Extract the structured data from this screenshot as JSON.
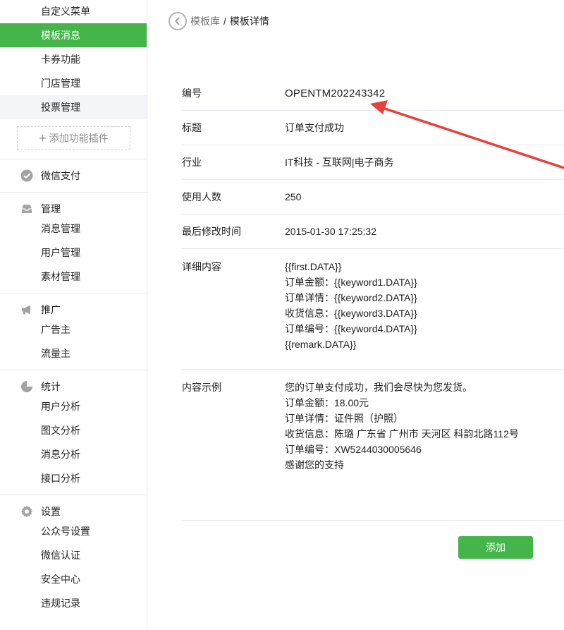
{
  "sidebar": {
    "top_items": [
      "自定义菜单",
      "模板消息",
      "卡券功能",
      "门店管理",
      "投票管理"
    ],
    "add_plugin_label": "添加功能插件",
    "wechat_pay": "微信支付",
    "manage": {
      "title": "管理",
      "items": [
        "消息管理",
        "用户管理",
        "素材管理"
      ]
    },
    "promote": {
      "title": "推广",
      "items": [
        "广告主",
        "流量主"
      ]
    },
    "stats": {
      "title": "统计",
      "items": [
        "用户分析",
        "图文分析",
        "消息分析",
        "接口分析"
      ]
    },
    "settings": {
      "title": "设置",
      "items": [
        "公众号设置",
        "微信认证",
        "安全中心",
        "违规记录"
      ]
    }
  },
  "breadcrumb": {
    "parent": "模板库",
    "separator": "/",
    "current": "模板详情"
  },
  "detail": {
    "id_label": "编号",
    "id_value": "OPENTM202243342",
    "title_label": "标题",
    "title_value": "订单支付成功",
    "industry_label": "行业",
    "industry_value": "IT科技 - 互联网|电子商务",
    "users_label": "使用人数",
    "users_value": "250",
    "modified_label": "最后修改时间",
    "modified_value": "2015-01-30 17:25:32",
    "content_label": "详细内容",
    "content_lines": [
      "{{first.DATA}}",
      "订单金额：{{keyword1.DATA}}",
      "订单详情：{{keyword2.DATA}}",
      "收货信息：{{keyword3.DATA}}",
      "订单编号：{{keyword4.DATA}}",
      "{{remark.DATA}}"
    ],
    "example_label": "内容示例",
    "example_lines": [
      "您的订单支付成功，我们会尽快为您发货。",
      "订单金额：18.00元",
      "订单详情：证件照（护照）",
      "收货信息：陈璐 广东省 广州市 天河区 科韵北路112号",
      "订单编号：XW5244030005646",
      "感谢您的支持"
    ]
  },
  "add_button_label": "添加",
  "colors": {
    "accent": "#44b549",
    "annotation": "#e8403a",
    "icon": "#a3a3a3"
  }
}
